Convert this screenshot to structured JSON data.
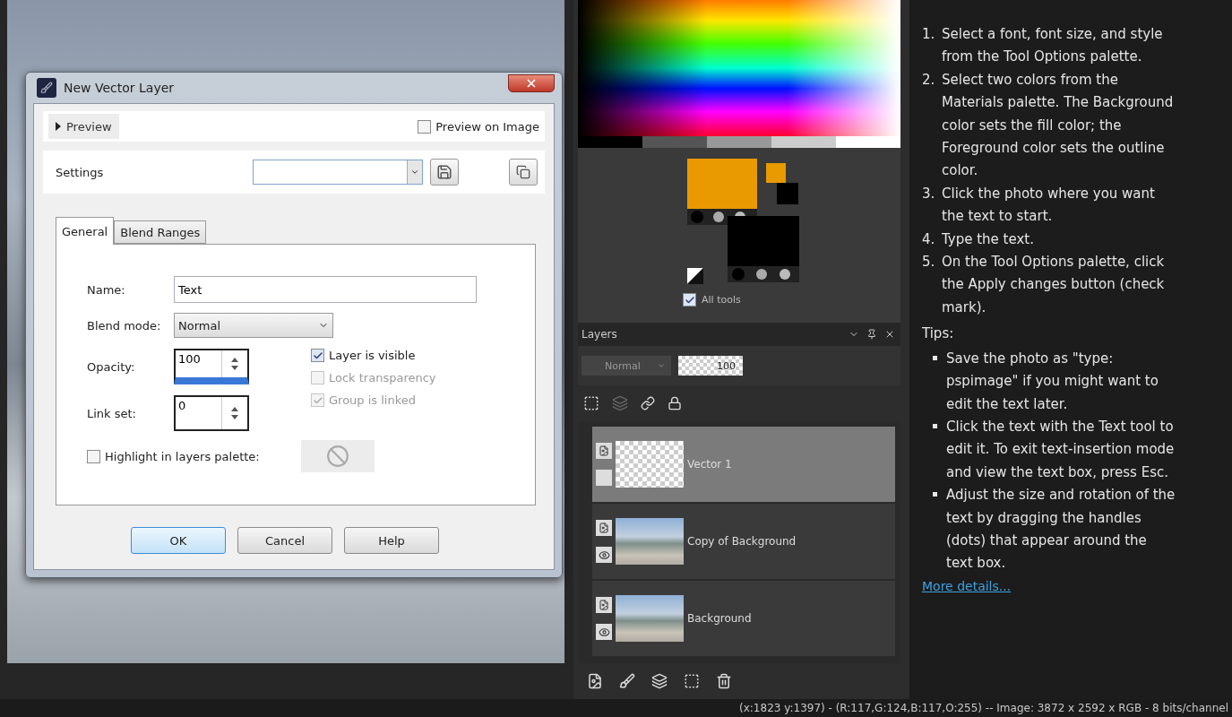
{
  "dialog": {
    "title": "New Vector Layer",
    "preview": {
      "label": "Preview",
      "expanded": false
    },
    "preview_on_image": {
      "label": "Preview on Image",
      "checked": false
    },
    "settings": {
      "label": "Settings"
    },
    "tabs": [
      {
        "label": "General",
        "selected": true
      },
      {
        "label": "Blend Ranges",
        "selected": false
      }
    ],
    "name": {
      "label": "Name:",
      "value": "Text"
    },
    "blend_mode": {
      "label": "Blend mode:",
      "value": "Normal"
    },
    "opacity": {
      "label": "Opacity:",
      "value": "100"
    },
    "link_set": {
      "label": "Link set:",
      "value": "0"
    },
    "checkboxes": [
      {
        "label": "Layer is visible",
        "checked": true,
        "disabled": false
      },
      {
        "label": "Lock transparency",
        "checked": false,
        "disabled": true
      },
      {
        "label": "Group is linked",
        "checked": true,
        "disabled": true
      }
    ],
    "highlight": {
      "label": "Highlight in layers palette:",
      "checked": false
    },
    "buttons": [
      {
        "label": "OK",
        "default": true
      },
      {
        "label": "Cancel",
        "default": false
      },
      {
        "label": "Help",
        "default": false
      }
    ]
  },
  "materials": {
    "all_tools": {
      "label": "All tools",
      "checked": true
    }
  },
  "layers": {
    "title": "Layers",
    "blend_mode": "Normal",
    "opacity": "100",
    "items": [
      {
        "name": "Vector 1",
        "selected": true,
        "kind": "vector"
      },
      {
        "name": "Copy of Background",
        "selected": false,
        "kind": "raster"
      },
      {
        "name": "Background",
        "selected": false,
        "kind": "raster"
      }
    ]
  },
  "help": {
    "steps": [
      {
        "number": "1.",
        "text": "Select a font, font size, and style from the Tool Options palette."
      },
      {
        "number": "2.",
        "text": "Select two colors from the Materials palette. The Background color sets the fill color; the Foreground color sets the outline color."
      },
      {
        "number": "3.",
        "text": "Click the photo where you want the text to start."
      },
      {
        "number": "4.",
        "text": "Type the text."
      },
      {
        "number": "5.",
        "text": "On the Tool Options palette, click the Apply changes button (check mark)."
      }
    ],
    "tips_title": "Tips:",
    "tips": [
      "Save the photo as \"type: pspimage\" if you might want to edit the text later.",
      "Click the text with the Text tool to edit it. To exit text-insertion mode and view the text box, press Esc.",
      "Adjust the size and rotation of the text by dragging the handles (dots) that appear around the text box."
    ],
    "link": "More details..."
  },
  "status_bar": "(x:1823 y:1397) - (R:117,G:124,B:117,O:255) -- Image: 3872 x 2592 x RGB - 8 bits/channel"
}
